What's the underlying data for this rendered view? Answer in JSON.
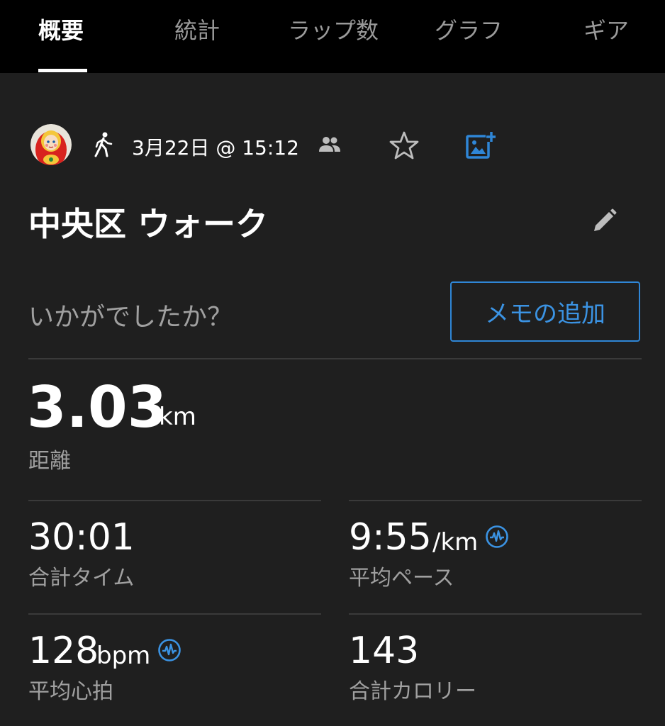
{
  "tabs": [
    {
      "label": "概要",
      "active": true
    },
    {
      "label": "統計",
      "active": false
    },
    {
      "label": "ラップ数",
      "active": false
    },
    {
      "label": "グラフ",
      "active": false
    },
    {
      "label": "ギア",
      "active": false
    }
  ],
  "activity": {
    "date_time": "3月22日 @ 15:12",
    "title": "中央区 ウォーク",
    "prompt": "いかがでしたか？",
    "memo_button": "メモの追加",
    "icons": {
      "avatar": "avatar-doll",
      "type": "walk-icon",
      "group": "group-icon",
      "favorite": "star-icon",
      "photo": "add-photo-icon",
      "edit": "pencil-icon"
    }
  },
  "distance": {
    "value": "3.03",
    "unit": "km",
    "label": "距離"
  },
  "stats": {
    "time": {
      "value": "30:01",
      "unit": "",
      "label": "合計タイム"
    },
    "pace": {
      "value": "9:55",
      "unit": "/km",
      "label": "平均ペース"
    },
    "heart_rate": {
      "value": "128",
      "unit": "bpm",
      "label": "平均心拍"
    },
    "calories": {
      "value": "143",
      "unit": "",
      "label": "合計カロリー"
    }
  },
  "colors": {
    "background": "#1f1f1f",
    "tabbar": "#000000",
    "accent": "#2f86d6",
    "muted_text": "#a0a0a0"
  }
}
